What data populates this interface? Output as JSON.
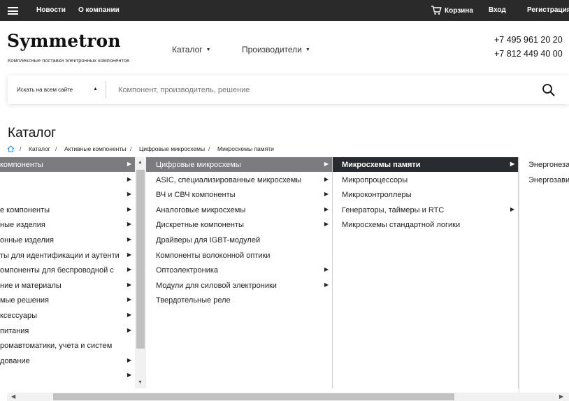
{
  "topbar": {
    "news": "Новости",
    "about": "О компании",
    "cart": "Корзина",
    "login": "Вход",
    "register": "Регистрация"
  },
  "header": {
    "logo": "Symmetron",
    "tagline": "Комплексные поставки электронных компонентов",
    "nav_catalog": "Каталог",
    "nav_manufacturers": "Производители",
    "phone1": "+7 495 961 20 20",
    "phone2": "+7 812 449 40 00"
  },
  "search": {
    "scope": "Искать на всем сайте",
    "placeholder": "Компонент, производитель, решение"
  },
  "page": {
    "title": "Каталог"
  },
  "breadcrumb": [
    "Каталог",
    "Активные компоненты",
    "Цифровые микросхемы",
    "Микросхемы памяти"
  ],
  "menu": {
    "col1": [
      {
        "label": "компоненты",
        "arrow": true
      },
      {
        "label": "",
        "arrow": true
      },
      {
        "label": "",
        "arrow": true
      },
      {
        "label": "е компоненты",
        "arrow": true
      },
      {
        "label": "ные изделия",
        "arrow": true
      },
      {
        "label": "онные изделия",
        "arrow": true
      },
      {
        "label": "ты для идентификации и аутенти",
        "arrow": true
      },
      {
        "label": "омпоненты для беспроводной с",
        "arrow": true
      },
      {
        "label": "ние и материалы",
        "arrow": true
      },
      {
        "label": "мые решения",
        "arrow": true
      },
      {
        "label": "ксессуары",
        "arrow": true
      },
      {
        "label": "питания",
        "arrow": true
      },
      {
        "label": "ромавтоматики, учета и систем",
        "arrow": false
      },
      {
        "label": "дование",
        "arrow": true
      },
      {
        "label": "",
        "arrow": true
      }
    ],
    "col2": [
      {
        "label": "Цифровые микросхемы",
        "arrow": true
      },
      {
        "label": "ASIC, специализированные микросхемы",
        "arrow": true
      },
      {
        "label": "ВЧ и СВЧ компоненты",
        "arrow": true
      },
      {
        "label": "Аналоговые микросхемы",
        "arrow": true
      },
      {
        "label": "Дискретные компоненты",
        "arrow": true
      },
      {
        "label": "Драйверы для IGBT-модулей",
        "arrow": false
      },
      {
        "label": "Компоненты волоконной оптики",
        "arrow": false
      },
      {
        "label": "Оптоэлектроника",
        "arrow": true
      },
      {
        "label": "Модули для силовой электроники",
        "arrow": true
      },
      {
        "label": "Твердотельные реле",
        "arrow": false
      }
    ],
    "col3": [
      {
        "label": "Микросхемы памяти",
        "arrow": true
      },
      {
        "label": "Микропроцессоры",
        "arrow": false
      },
      {
        "label": "Микроконтроллеры",
        "arrow": false
      },
      {
        "label": "Генераторы, таймеры и RTC",
        "arrow": true
      },
      {
        "label": "Микросхемы стандартной логики",
        "arrow": false
      }
    ],
    "col4": [
      {
        "label": "Энергонеза"
      },
      {
        "label": "Энергозави"
      }
    ]
  },
  "colors": {
    "topbar": "#2a2a2a",
    "active_grey": "#7c7c80",
    "active_dark": "#282c30",
    "home_icon": "#2a8fd6"
  }
}
